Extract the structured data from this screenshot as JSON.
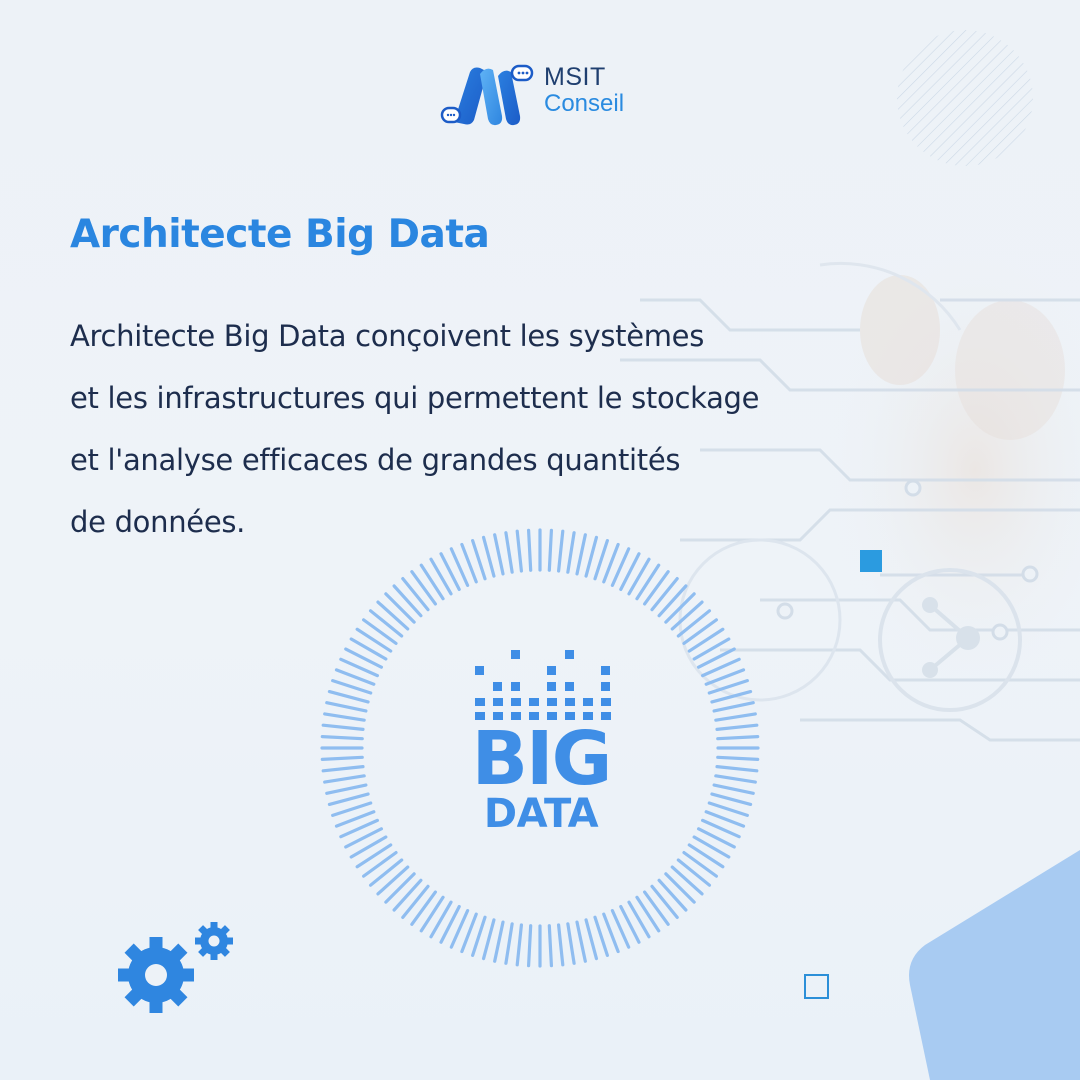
{
  "brand": {
    "line1": "MSIT",
    "line2": "Conseil"
  },
  "heading": "Architecte Big Data",
  "body_lines": [
    "Architecte Big Data conçoivent les systèmes",
    "et les infrastructures qui permettent le stockage",
    "et l'analyse efficaces de grandes quantités",
    "de données."
  ],
  "emblem": {
    "word_top": "BIG",
    "word_bottom": "DATA"
  },
  "colors": {
    "accent": "#2a86e0",
    "text": "#1d2d4d",
    "brand_dark": "#1f3f6f",
    "light_blue": "#9ec5f0",
    "background": "#edf2f7"
  },
  "icons": [
    "gears-icon",
    "ring-icon",
    "pixel-bars-icon",
    "circuit-background",
    "chat-bubble-icon"
  ]
}
